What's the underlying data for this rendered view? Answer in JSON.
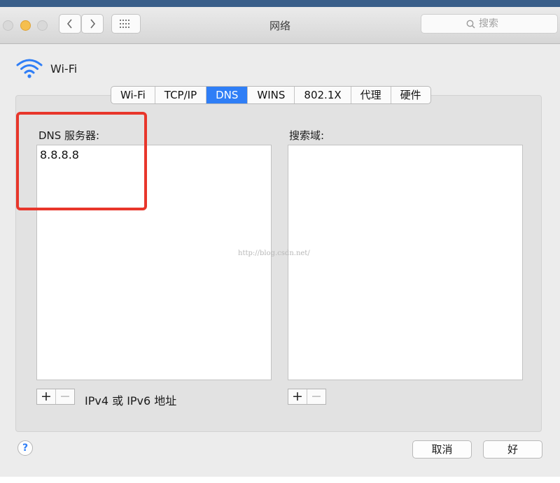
{
  "window": {
    "title": "网络",
    "search_placeholder": "搜索"
  },
  "interface": {
    "name": "Wi-Fi"
  },
  "tabs": [
    {
      "label": "Wi-Fi"
    },
    {
      "label": "TCP/IP"
    },
    {
      "label": "DNS",
      "active": true
    },
    {
      "label": "WINS"
    },
    {
      "label": "802.1X"
    },
    {
      "label": "代理"
    },
    {
      "label": "硬件"
    }
  ],
  "dns": {
    "servers_label": "DNS 服务器:",
    "servers": [
      "8.8.8.8"
    ],
    "search_domains_label": "搜索域:",
    "address_hint": "IPv4 或 IPv6 地址"
  },
  "controls": {
    "add": "+",
    "remove": "−",
    "help": "?",
    "cancel": "取消",
    "ok": "好"
  },
  "watermark": "http://blog.csdn.net/",
  "colors": {
    "accent": "#2f7ef6",
    "highlight": "#e8362b",
    "minimize": "#f5bf4f"
  }
}
